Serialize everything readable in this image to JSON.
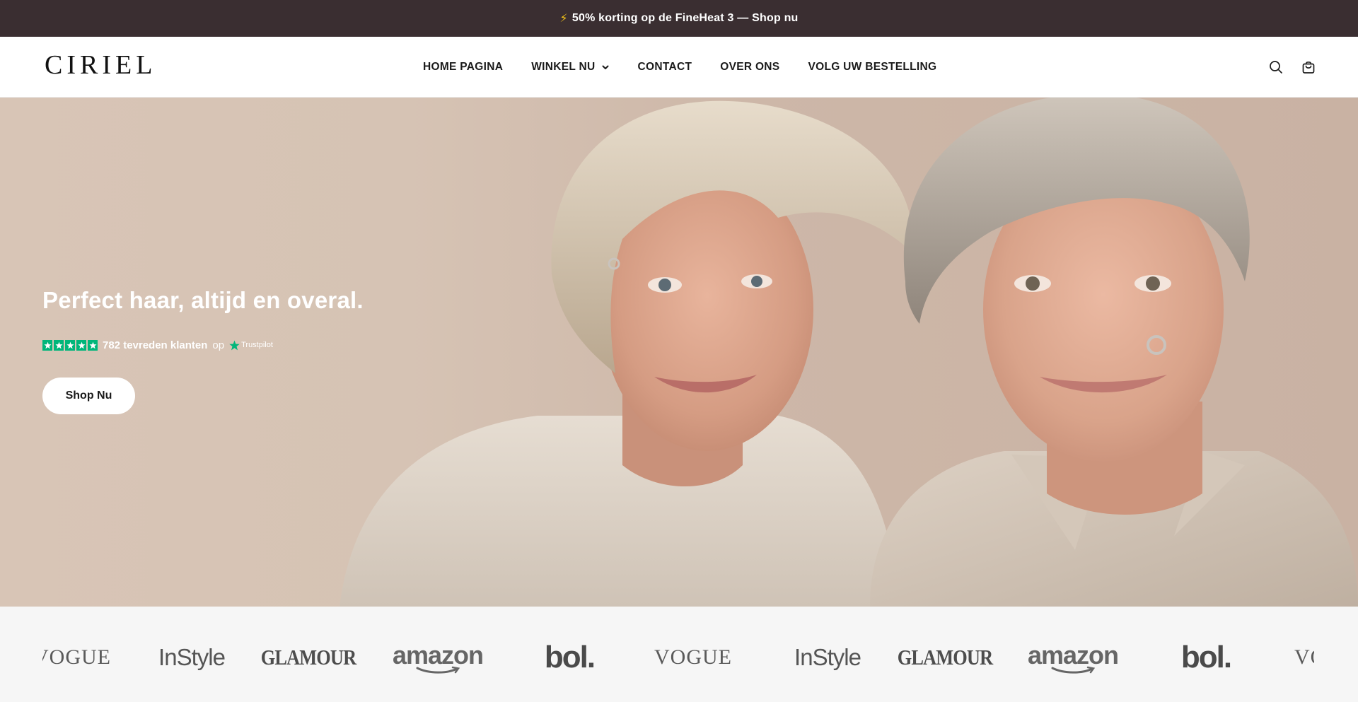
{
  "announcement": {
    "icon": "lightning-icon",
    "text": "50% korting op de FineHeat 3 — Shop nu"
  },
  "header": {
    "logo": "CIRIEL",
    "nav": [
      {
        "label": "HOME PAGINA"
      },
      {
        "label": "WINKEL NU",
        "has_dropdown": true
      },
      {
        "label": "CONTACT"
      },
      {
        "label": "OVER ONS"
      },
      {
        "label": "VOLG UW BESTELLING"
      }
    ],
    "icons": [
      "search-icon",
      "cart-icon"
    ]
  },
  "hero": {
    "title": "Perfect haar, altijd en overal.",
    "rating": {
      "stars": 5,
      "count_text": "782 tevreden klanten",
      "on_text": "op",
      "platform": "Trustpilot"
    },
    "cta_label": "Shop Nu"
  },
  "press_logos": [
    "VOGUE",
    "InStyle",
    "GLAMOUR",
    "amazon",
    "bol.",
    "VOGUE",
    "InStyle",
    "GLAMOUR",
    "amazon",
    "bol.",
    "VOGUE"
  ],
  "colors": {
    "announcement_bg": "#3a2e31",
    "trustpilot_green": "#00b67a",
    "press_bg": "#f6f6f6"
  }
}
